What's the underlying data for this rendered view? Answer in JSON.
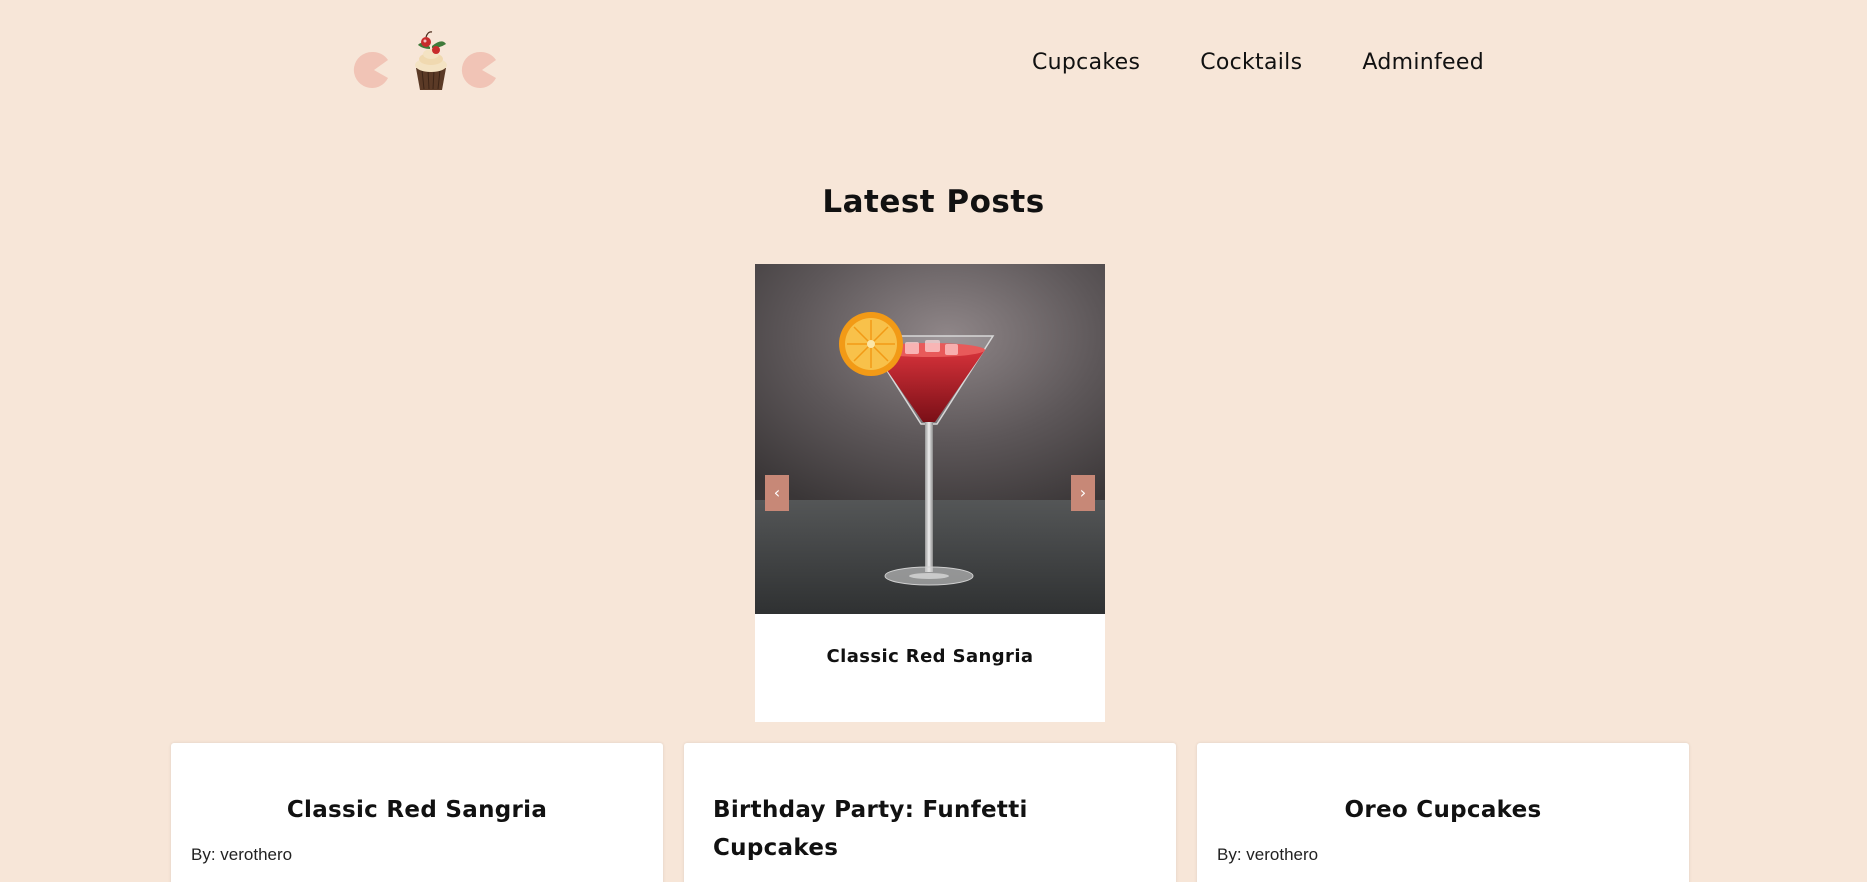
{
  "header": {
    "nav": [
      {
        "label": "Cupcakes"
      },
      {
        "label": "Cocktails"
      },
      {
        "label": "Adminfeed"
      }
    ]
  },
  "main": {
    "title": "Latest Posts",
    "carousel": {
      "caption": "Classic Red Sangria",
      "prev_symbol": "‹",
      "next_symbol": "›"
    },
    "cards": [
      {
        "title": "Classic Red Sangria",
        "author": "By: verothero"
      },
      {
        "title": "Birthday Party: Funfetti Cupcakes",
        "author": ""
      },
      {
        "title": "Oreo Cupcakes",
        "author": "By: verothero"
      }
    ]
  },
  "colors": {
    "background": "#f7e6d8",
    "accent": "#c78877",
    "logo_pink": "#f1c4b6"
  }
}
